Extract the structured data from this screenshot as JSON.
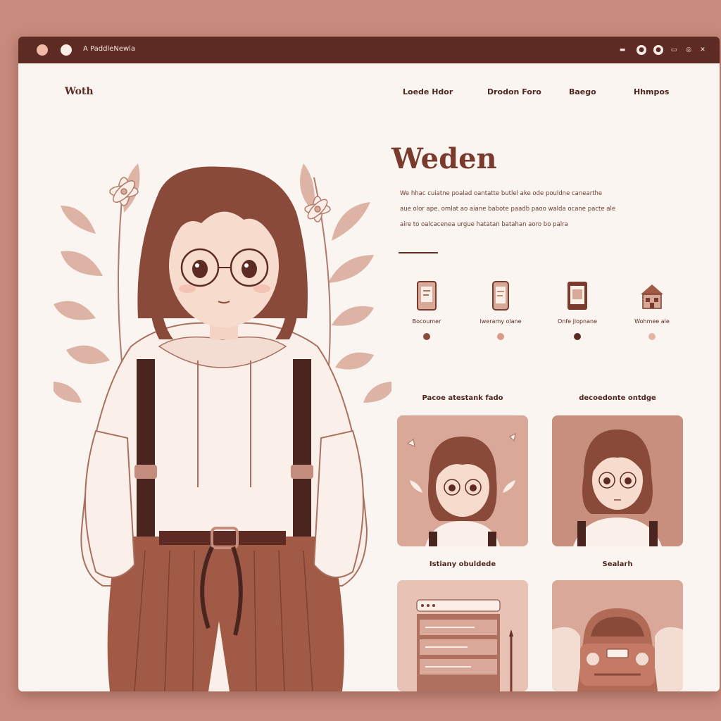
{
  "window": {
    "title": "A PaddleNewla"
  },
  "titlebar": {
    "controls": [
      "▬",
      "●",
      "●",
      "▭",
      "◎",
      "✕"
    ]
  },
  "brand": "Woth",
  "nav": [
    {
      "label": "Loede Hdor"
    },
    {
      "label": "Drodon Foro"
    },
    {
      "label": "Baego"
    },
    {
      "label": "Hhmpos"
    }
  ],
  "hero": {
    "title": "Weden",
    "description_lines": [
      "We hhac cuiatne poalad oantatte butlel ake ode pouldne canearthe",
      "aue olor ape. omlat ao aiane babote paadb paoo walda ocane pacte ale",
      "aire to oalcacenea urgue hatatan batahan aoro bo palra"
    ]
  },
  "features": [
    {
      "label": "Bocoumer",
      "icon": "tablet-icon",
      "dot_color": "#8a4a3c"
    },
    {
      "label": "Iweramy olane",
      "icon": "phone-icon",
      "dot_color": "#d99a88"
    },
    {
      "label": "Onfe jlopnane",
      "icon": "device-icon",
      "dot_color": "#5e2b24"
    },
    {
      "label": "Wohmee ale",
      "icon": "house-icon",
      "dot_color": "#e2b4a6"
    }
  ],
  "gallery": [
    {
      "title": "Pacoe atestank fado",
      "art": "girl-with-flowers-portrait"
    },
    {
      "title": "decoedonte ontdge",
      "art": "girl-with-glasses-portrait"
    },
    {
      "title": "Istiany obuldede",
      "art": "browser-stack-illustration"
    },
    {
      "title": "Sealarh",
      "art": "car-front-illustration"
    }
  ],
  "colors": {
    "background": "#c78a7d",
    "window": "#fbf5f1",
    "titlebar": "#5e2b24",
    "accent": "#7a3a2c",
    "card": "#d9a898"
  }
}
